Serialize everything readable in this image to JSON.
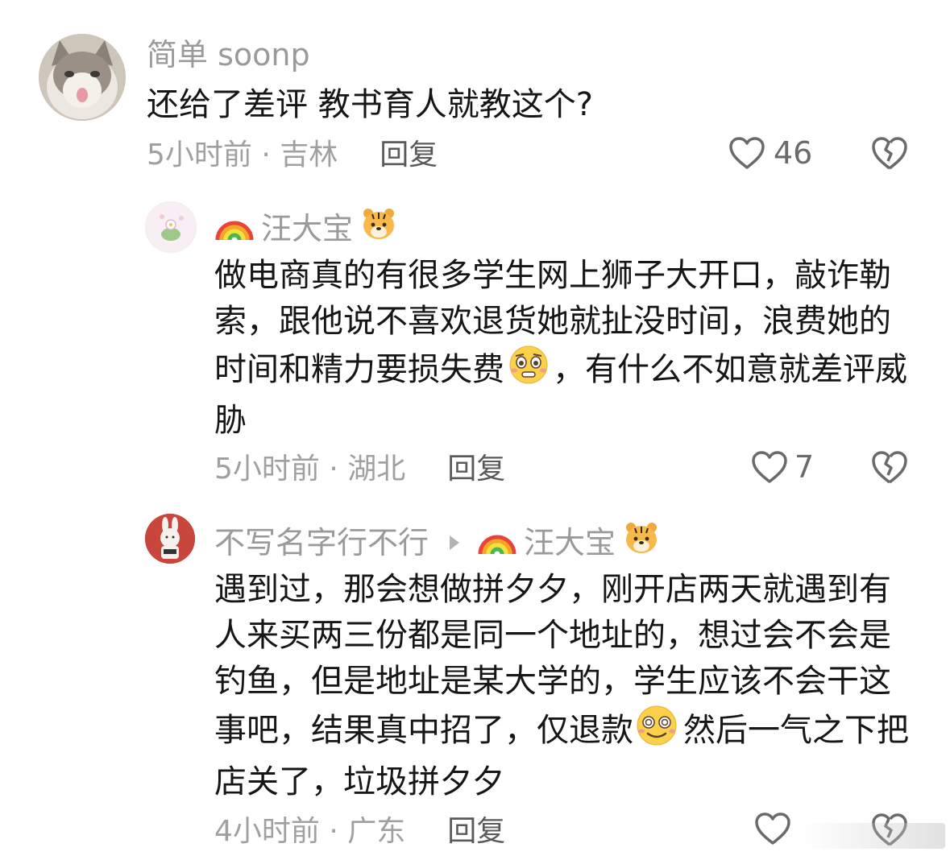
{
  "comments": [
    {
      "username": "简单 soonp",
      "text": "还给了差评 教书育人就教这个?",
      "time": "5小时前",
      "location": "吉林",
      "reply_label": "回复",
      "likes": "46",
      "avatar": "cat-avatar"
    },
    {
      "username": "汪大宝",
      "text_before_emoji": "做电商真的有很多学生网上狮子大开口，敲诈勒索，跟他说不喜欢退货她就扯没时间，浪费她的时间和精力要损失费",
      "text_after_emoji": "，有什么不如意就差评威胁",
      "emoji": "pleading-face",
      "time": "5小时前",
      "location": "湖北",
      "reply_label": "回复",
      "likes": "7",
      "avatar": "flower-avatar"
    },
    {
      "username": "不写名字行不行",
      "reply_to": "汪大宝",
      "text_line1": "遇到过，那会想做拼夕夕，刚开店两天就遇到有人来买两三份都是同一个地址的，想过会不会是钓鱼，但是地址是某大学的，学生应该不会干这事吧，结果真中招了，仅退款",
      "text_after_emoji": "然后一气之下把店关了，垃圾拼夕夕",
      "emoji": "dizzy-smile-face",
      "time": "4小时前",
      "location": "广东",
      "reply_label": "回复",
      "avatar": "bunny-avatar"
    }
  ],
  "colors": {
    "text": "#161616",
    "meta": "#a0a0a0",
    "reply": "#5a5a5a",
    "icon": "#6a6a6a"
  }
}
